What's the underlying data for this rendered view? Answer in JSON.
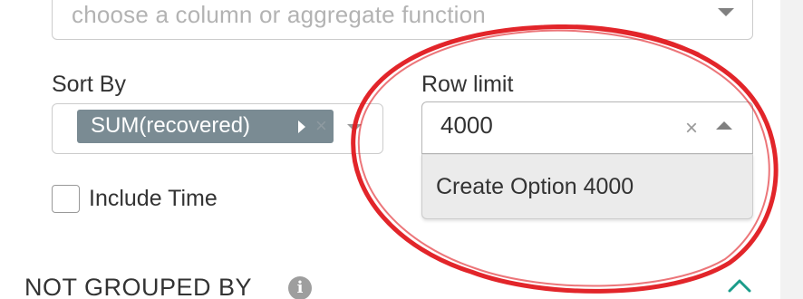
{
  "metrics_select": {
    "placeholder": "choose a column or aggregate function",
    "icon": "chevron-down-icon"
  },
  "sort_by": {
    "label": "Sort By",
    "tag_label": "SUM(recovered)",
    "tag_remove": "×"
  },
  "row_limit": {
    "label": "Row limit",
    "value": "4000",
    "clear": "×",
    "dropdown_option": "Create Option 4000"
  },
  "include_time": {
    "label": "Include Time",
    "checked": false
  },
  "section": {
    "title": "NOT GROUPED BY",
    "info": "i"
  },
  "colors": {
    "tag_bg": "#7a8b93",
    "annotation": "#e0191f",
    "chevron": "#1a9c8a"
  }
}
